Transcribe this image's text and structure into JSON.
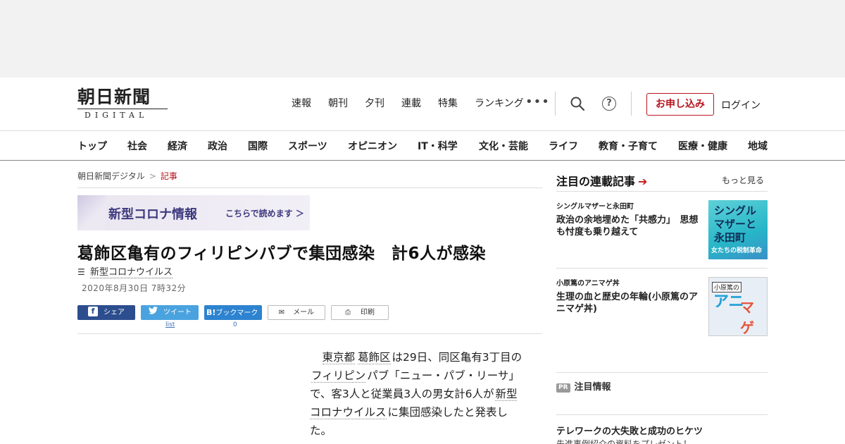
{
  "logo": {
    "main": "朝日新聞",
    "sub": "DIGITAL"
  },
  "top_nav": [
    "速報",
    "朝刊",
    "夕刊",
    "連載",
    "特集",
    "ランキング"
  ],
  "more_label": "•••",
  "help_label": "?",
  "apply_button": "お申し込み",
  "login_label": "ログイン",
  "category_nav": [
    "トップ",
    "社会",
    "経済",
    "政治",
    "国際",
    "スポーツ",
    "オピニオン",
    "IT・科学",
    "文化・芸能",
    "ライフ",
    "教育・子育て",
    "医療・健康",
    "地域"
  ],
  "breadcrumb": {
    "home": "朝日新聞デジタル",
    "sep": ">",
    "current": "記事"
  },
  "banner": {
    "title": "新型コロナ情報",
    "link": "こちらで読めます ＞"
  },
  "article": {
    "headline": "葛飾区亀有のフィリピンパブで集団感染　計6人が感染",
    "tag": "新型コロナウイルス",
    "date": "2020年8月30日 7時32分",
    "body": {
      "kw1": "東京都",
      "kw2": "葛飾区",
      "t1": "は29日、同区亀有3丁目の",
      "kw3": "フィリピン",
      "t2": "パブ「ニュー・パブ・リーサ」で、客3人と従業員3人の男女計6人が",
      "kw4": "新型コロナウイルス",
      "t3": "に集団感染したと発表した。"
    }
  },
  "share": {
    "facebook": "シェア",
    "twitter": "ツイート",
    "hatena": "ブックマーク",
    "hatena_icon": "B!",
    "mail": "メール",
    "print": "印刷",
    "twitter_count": "list",
    "hatena_count": "0"
  },
  "sidebar": {
    "heading": "注目の連載記事",
    "more": "もっと見る",
    "items": [
      {
        "series": "シングルマザーと永田町",
        "title": "政治の余地埋めた「共感力」　思想も忖度も乗り越えて",
        "thumb_a": "シングル\nマザーと\n永田町",
        "thumb_b": "女たちの税制革命"
      },
      {
        "series": "小原篤のアニマゲ丼",
        "title": "生理の血と歴史の年輪(小原篤のアニマゲ丼)",
        "thumb_a": "小原篤の",
        "thumb_b": "アニ",
        "thumb_c": "マゲ"
      }
    ],
    "pr_badge": "PR",
    "pr_heading": "注目情報",
    "pr_title": "テレワークの大失敗と成功のヒケツ",
    "pr_sub": "先進事例紹介の資料をプレゼント！"
  },
  "colors": {
    "brand_red": "#b8141e",
    "facebook": "#2c4d8e",
    "twitter": "#4aa3df",
    "hatena": "#2d83cf",
    "banner_text": "#3e3a7e"
  }
}
